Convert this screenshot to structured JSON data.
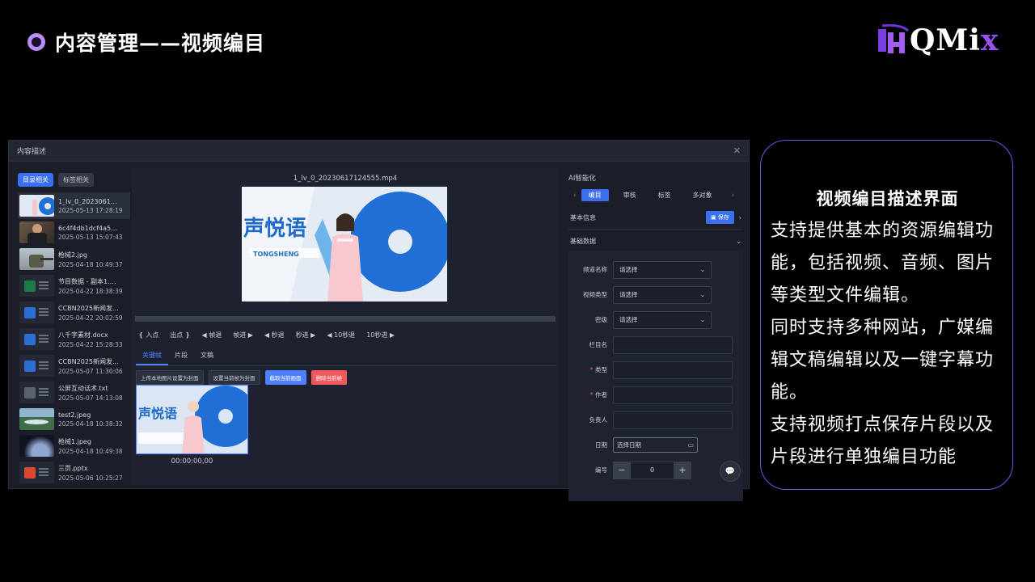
{
  "slide": {
    "title": "内容管理——视频编目",
    "logo_text": "QMi",
    "logo_accent": "x",
    "colors": {
      "accent": "#b88cf0",
      "brand_purple": "#9b4ff2",
      "card_border": "#6a55f0",
      "primary_blue": "#3a6ff0"
    }
  },
  "app": {
    "title": "内容描述",
    "left": {
      "tabs": [
        "目录相关",
        "标签相关"
      ],
      "files": [
        {
          "name": "1_lv_0_202306171...",
          "date": "2025-05-13 17:28:19",
          "thumb": "video"
        },
        {
          "name": "6c4f4db1dcf4a5779...",
          "date": "2025-05-13 15:07:43",
          "thumb": "photo-man"
        },
        {
          "name": "枪械2.jpg",
          "date": "2025-04-18 10:49:37",
          "thumb": "photo-soldier"
        },
        {
          "name": "节目数据 - 副本1.xlsx",
          "date": "2025-04-22 18:38:39",
          "thumb": "excel"
        },
        {
          "name": "CCBN2025新闻发...",
          "date": "2025-04-22 20:02:59",
          "thumb": "word"
        },
        {
          "name": "八千字素材.docx",
          "date": "2025-04-22 15:28:33",
          "thumb": "word"
        },
        {
          "name": "CCBN2025新闻发...",
          "date": "2025-05-07 11:30:06",
          "thumb": "word"
        },
        {
          "name": "公屏互动话术.txt",
          "date": "2025-05-07 14:13:08",
          "thumb": "txt"
        },
        {
          "name": "test2.jpeg",
          "date": "2025-04-18 10:38:32",
          "thumb": "photo-landscape"
        },
        {
          "name": "枪械1.jpeg",
          "date": "2025-04-18 10:49:38",
          "thumb": "photo-space"
        },
        {
          "name": "三页.pptx",
          "date": "2025-05-06 10:25:27",
          "thumb": "ppt"
        }
      ]
    },
    "middle": {
      "video_name": "1_lv_0_20230617124555.mp4",
      "controls": [
        "❴ 入点",
        "出点 ❵",
        "◀ 帧退",
        "帧进 ▶",
        "◀ 秒退",
        "秒进 ▶",
        "◀ 10秒退",
        "10秒进 ▶"
      ],
      "subtabs": [
        "关键帧",
        "片段",
        "文稿"
      ],
      "actions": [
        "上传本地图片设置为封面",
        "设置当前帧为封面",
        "截取当前画面",
        "删除当前帧"
      ],
      "keyframe_time": "00:00:00,00"
    },
    "right": {
      "ai_title": "AI智能化",
      "ai_tabs": [
        "编目",
        "审核",
        "标签",
        "多对象"
      ],
      "basic_info": "基本信息",
      "save": "保存",
      "basic_data": "基础数据",
      "fields": {
        "channel": {
          "label": "频道名称",
          "value": "请选择"
        },
        "video_type": {
          "label": "视频类型",
          "value": "请选择"
        },
        "secret": {
          "label": "密级",
          "value": "请选择"
        },
        "column": {
          "label": "栏目名"
        },
        "type": {
          "label": "类型"
        },
        "author": {
          "label": "作者"
        },
        "owner": {
          "label": "负责人"
        },
        "date": {
          "label": "日期",
          "placeholder": "选择日期"
        },
        "number": {
          "label": "编号",
          "value": "0"
        }
      }
    }
  },
  "card": {
    "heading": "视频编目描述界面",
    "p1": "支持提供基本的资源编辑功能，包括视频、音频、图片等类型文件编辑。",
    "p2": "同时支持多种网站，广媒编辑文稿编辑以及一键字幕功能。",
    "p3": "支持视频打点保存片段以及片段进行单独编目功能"
  }
}
